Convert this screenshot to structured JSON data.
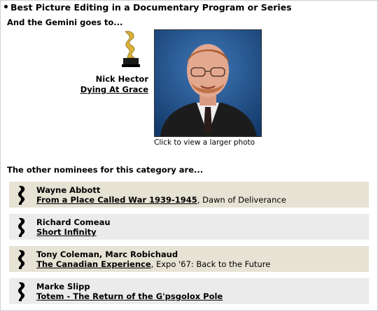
{
  "colors": {
    "nominee_bg_a": "#e6e2d4",
    "nominee_bg_b": "#ebebeb",
    "trophy_gold": "#d9b23a",
    "photo_bg": "#1f4f8f"
  },
  "category": {
    "title": "Best Picture Editing in a Documentary Program or Series"
  },
  "winner": {
    "intro": "And the Gemini goes to...",
    "name": "Nick Hector",
    "program": "Dying At Grace",
    "photo_caption": "Click to view a larger photo",
    "trophy_icon": "gemini-trophy-icon"
  },
  "nominees": {
    "heading": "The other nominees for this category are...",
    "items": [
      {
        "name": "Wayne Abbott",
        "program": "From a Place Called War 1939-1945",
        "episode": ", Dawn of Deliverance",
        "bg": "#e6e2d4"
      },
      {
        "name": "Richard Comeau",
        "program": "Short Infinity",
        "episode": "",
        "bg": "#ebebeb"
      },
      {
        "name": "Tony Coleman, Marc Robichaud",
        "program": "The Canadian Experience",
        "episode": ", Expo '67: Back to the Future",
        "bg": "#e6e2d4"
      },
      {
        "name": "Marke Slipp",
        "program": "Totem - The Return of the G'psgolox Pole",
        "episode": "",
        "bg": "#ebebeb"
      }
    ]
  }
}
